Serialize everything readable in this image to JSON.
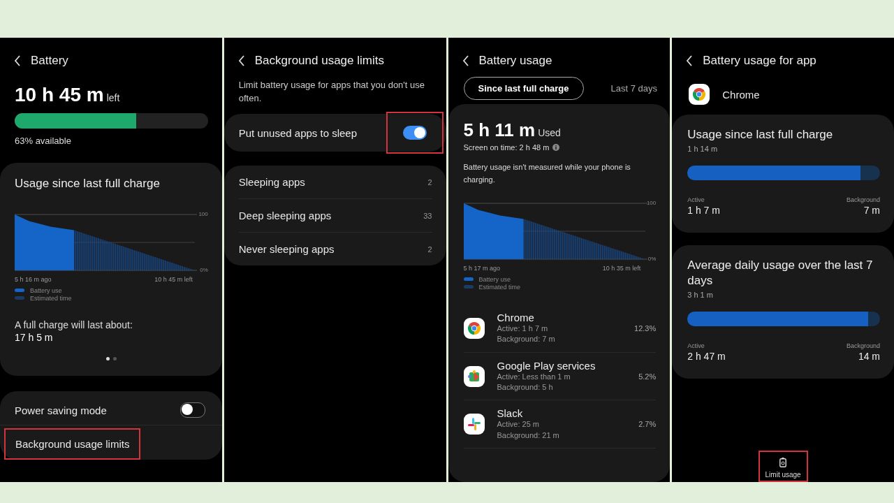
{
  "panels": [
    {
      "kind": "battery",
      "title": "Battery",
      "time": "10 h 45 m",
      "time_suffix": "left",
      "level": 0.63,
      "available": "63% available",
      "usage_card": {
        "title": "Usage since last full charge",
        "graph": {
          "y_labels": [
            "100",
            "0%"
          ],
          "x_labels": [
            "5 h 16 m ago",
            "10 h 45 m left"
          ],
          "legend": [
            {
              "label": "Battery use",
              "color": "#1565c9"
            },
            {
              "label": "Estimated time",
              "color": "#1b3a66"
            }
          ]
        },
        "full_charge_label": "A full charge will last about:",
        "full_charge_value": "17 h 5 m",
        "pager": [
          {
            "selected": true
          },
          {
            "selected": false
          }
        ]
      },
      "settings": [
        {
          "kind": "toggle",
          "label": "Power saving mode",
          "on": false,
          "highlighted": false
        },
        {
          "kind": "link",
          "label": "Background usage limits",
          "highlighted": true
        }
      ]
    },
    {
      "kind": "limits",
      "title": "Background usage limits",
      "description": "Limit battery usage for apps that you don't use often.",
      "sleep_toggle": {
        "label": "Put unused apps to sleep",
        "on": true,
        "highlighted": true
      },
      "lists": [
        {
          "label": "Sleeping apps",
          "count": "2"
        },
        {
          "label": "Deep sleeping apps",
          "count": "33"
        },
        {
          "label": "Never sleeping apps",
          "count": "2"
        }
      ]
    },
    {
      "kind": "usage",
      "title": "Battery usage",
      "tabs": [
        {
          "label": "Since last full charge",
          "selected": true
        },
        {
          "label": "Last 7 days",
          "selected": false
        }
      ],
      "used": "5 h 11 m",
      "used_suffix": "Used",
      "screen_on": "Screen on time: 2 h 48 m",
      "note": "Battery usage isn't measured while your phone is charging.",
      "graph": {
        "y_labels": [
          "100",
          "0%"
        ],
        "x_labels": [
          "5 h 17 m ago",
          "10 h 35 m left"
        ],
        "legend": [
          {
            "label": "Battery use",
            "color": "#1565c9"
          },
          {
            "label": "Estimated time",
            "color": "#1b3a66"
          }
        ]
      },
      "apps": [
        {
          "kind": "chrome",
          "name": "Chrome",
          "active": "Active: 1 h 7 m",
          "background": "Background: 7 m",
          "share": "12.3%"
        },
        {
          "kind": "play",
          "name": "Google Play services",
          "active": "Active: Less than 1 m",
          "background": "Background: 5 h",
          "share": "5.2%"
        },
        {
          "kind": "slack",
          "name": "Slack",
          "active": "Active: 25 m",
          "background": "Background: 21 m",
          "share": "2.7%"
        }
      ]
    },
    {
      "kind": "app",
      "title": "Battery usage for app",
      "app": {
        "kind": "chrome",
        "name": "Chrome"
      },
      "cards": [
        {
          "title": "Usage since last full charge",
          "total": "1 h 14 m",
          "level": 0.9,
          "active_label": "Active",
          "active": "1 h 7 m",
          "background_label": "Background",
          "background": "7 m"
        },
        {
          "title": "Average daily usage over the last 7 days",
          "total": "3 h 1 m",
          "level": 0.94,
          "active_label": "Active",
          "active": "2 h 47 m",
          "background_label": "Background",
          "background": "14 m"
        }
      ],
      "limit_button": {
        "label": "Limit usage",
        "highlighted": true
      }
    }
  ]
}
